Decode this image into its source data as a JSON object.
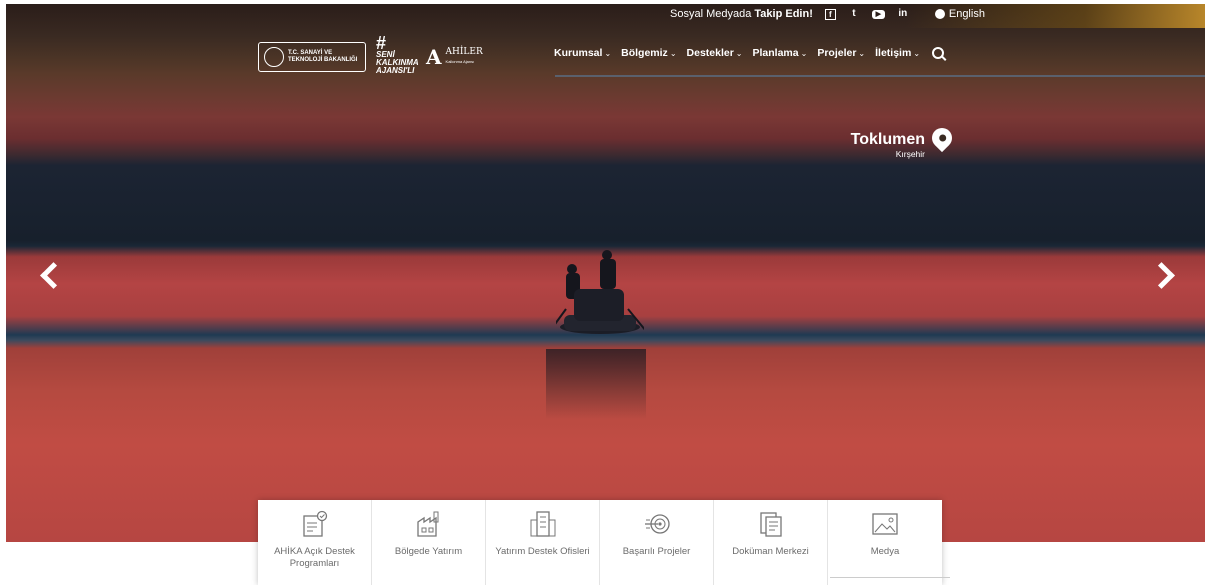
{
  "social": {
    "prefix": "Sosyal Medyada ",
    "bold": "Takip Edin!",
    "icons": [
      "facebook-icon",
      "twitter-icon",
      "youtube-icon",
      "linkedin-icon"
    ],
    "language": "English"
  },
  "logos": {
    "ministry": "T.C. SANAYİ VE TEKNOLOJİ BAKANLIĞI",
    "hashtag_line1": "SENİ",
    "hashtag_line2": "KALKINMA",
    "hashtag_line3": "AJANSI'LI",
    "agency_title": "AHİLER",
    "agency_sub": "Kalkınma Ajansı"
  },
  "nav": {
    "items": [
      "Kurumsal",
      "Bölgemiz",
      "Destekler",
      "Planlama",
      "Projeler",
      "İletişim"
    ]
  },
  "hero": {
    "location_name": "Toklumen",
    "location_city": "Kırşehir"
  },
  "tiles": [
    {
      "label": "AHİKA Açık Destek Programları",
      "icon": "support-document-icon"
    },
    {
      "label": "Bölgede Yatırım",
      "icon": "factory-icon"
    },
    {
      "label": "Yatırım Destek Ofisleri",
      "icon": "office-building-icon"
    },
    {
      "label": "Başarılı Projeler",
      "icon": "target-icon"
    },
    {
      "label": "Doküman Merkezi",
      "icon": "documents-icon"
    },
    {
      "label": "Medya",
      "icon": "image-icon"
    }
  ],
  "colors": {
    "accent_gold": "#b8862a",
    "tile_text": "#6b6b6b"
  }
}
